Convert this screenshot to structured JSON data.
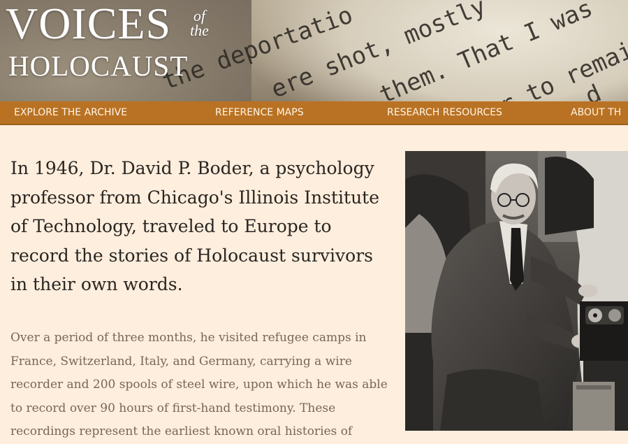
{
  "header": {
    "logo_line1": "VOICES",
    "logo_of": "of",
    "logo_the": "the",
    "logo_line2": "HOLOCAUST"
  },
  "nav": {
    "items": [
      {
        "label": "EXPLORE THE ARCHIVE"
      },
      {
        "label": "REFERENCE MAPS"
      },
      {
        "label": "RESEARCH RESOURCES"
      },
      {
        "label": "ABOUT TH"
      }
    ]
  },
  "main": {
    "heading": "In 1946, Dr. David P. Boder, a psychology professor from Chicago's Illinois Institute of Technology, traveled to Europe to record the stories of Holocaust survivors in their own words.",
    "body": "Over a period of three months, he visited refugee camps in France, Switzerland, Italy, and Germany, carrying a wire recorder and 200 spools of steel wire, upon which he was able to record over 90 hours of first-hand testimony. These recordings represent the earliest known oral histories of"
  },
  "background_typewriter": [
    "the deportatio",
    "ere shot, mostly",
    "them. That I was",
    "ver to remain in",
    "d"
  ],
  "colors": {
    "page_background": "#fdeedd",
    "nav_background": "#b97223",
    "nav_text": "#fff5e6",
    "heading_text": "#2a2521",
    "body_text": "#7a6654"
  }
}
